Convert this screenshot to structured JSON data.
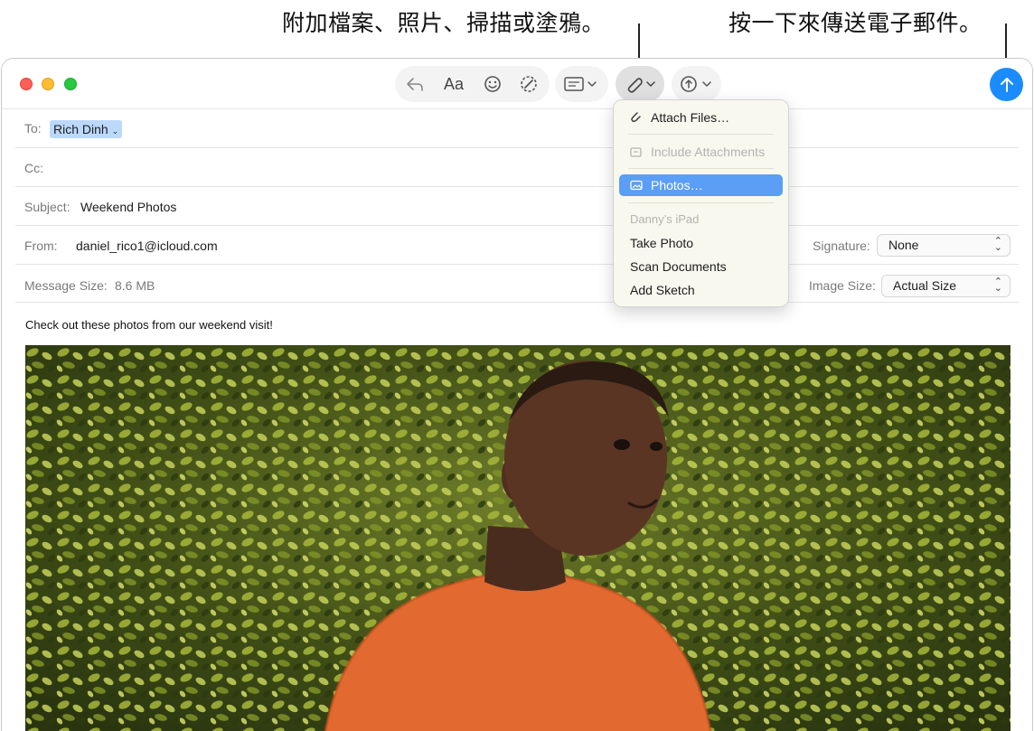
{
  "callouts": {
    "attach": "附加檔案、照片、掃描或塗鴉。",
    "send": "按一下來傳送電子郵件。"
  },
  "toolbar": {
    "font_label": "Aa",
    "icons": [
      "reply-icon",
      "emoji-icon",
      "markup-icon",
      "format-bar-icon",
      "attachment-icon",
      "media-icon"
    ],
    "send_icon": "arrow-up-icon"
  },
  "header": {
    "to_label": "To:",
    "to_value": "Rich Dinh",
    "cc_label": "Cc:",
    "subject_label": "Subject:",
    "subject_value": "Weekend Photos",
    "from_label": "From:",
    "from_value": "daniel_rico1@icloud.com",
    "signature_label": "Signature:",
    "signature_value": "None",
    "size_label": "Message Size:",
    "size_value": "8.6 MB",
    "image_size_label": "Image Size:",
    "image_size_value": "Actual Size"
  },
  "body": {
    "text": "Check out these photos from our weekend visit!"
  },
  "menu": {
    "attach_files": "Attach Files…",
    "include_attachments": "Include Attachments",
    "photos": "Photos…",
    "device_header": "Danny’s iPad",
    "take_photo": "Take Photo",
    "scan_documents": "Scan Documents",
    "add_sketch": "Add Sketch"
  },
  "colors": {
    "accent": "#1a8cff",
    "selection": "#5b9ef5",
    "token": "#bcd9fb"
  }
}
